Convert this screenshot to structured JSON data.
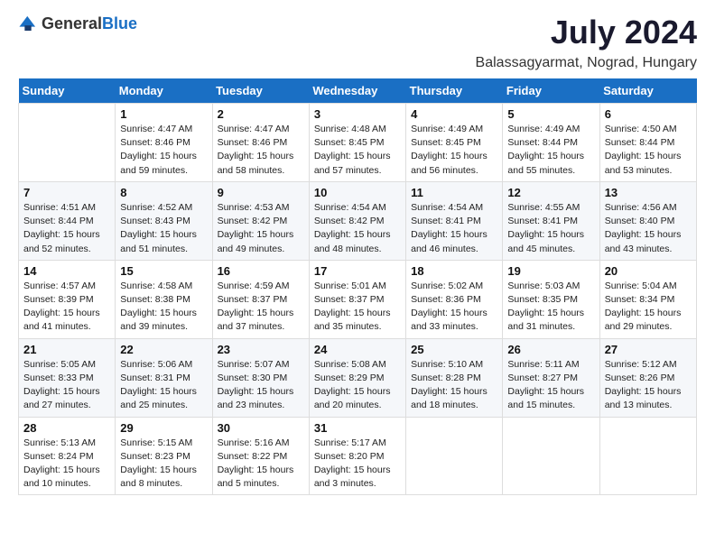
{
  "header": {
    "logo_general": "General",
    "logo_blue": "Blue",
    "month_year": "July 2024",
    "location": "Balassagyarmat, Nograd, Hungary"
  },
  "days_of_week": [
    "Sunday",
    "Monday",
    "Tuesday",
    "Wednesday",
    "Thursday",
    "Friday",
    "Saturday"
  ],
  "weeks": [
    [
      {
        "date": "",
        "sunrise": "",
        "sunset": "",
        "daylight": ""
      },
      {
        "date": "1",
        "sunrise": "Sunrise: 4:47 AM",
        "sunset": "Sunset: 8:46 PM",
        "daylight": "Daylight: 15 hours and 59 minutes."
      },
      {
        "date": "2",
        "sunrise": "Sunrise: 4:47 AM",
        "sunset": "Sunset: 8:46 PM",
        "daylight": "Daylight: 15 hours and 58 minutes."
      },
      {
        "date": "3",
        "sunrise": "Sunrise: 4:48 AM",
        "sunset": "Sunset: 8:45 PM",
        "daylight": "Daylight: 15 hours and 57 minutes."
      },
      {
        "date": "4",
        "sunrise": "Sunrise: 4:49 AM",
        "sunset": "Sunset: 8:45 PM",
        "daylight": "Daylight: 15 hours and 56 minutes."
      },
      {
        "date": "5",
        "sunrise": "Sunrise: 4:49 AM",
        "sunset": "Sunset: 8:44 PM",
        "daylight": "Daylight: 15 hours and 55 minutes."
      },
      {
        "date": "6",
        "sunrise": "Sunrise: 4:50 AM",
        "sunset": "Sunset: 8:44 PM",
        "daylight": "Daylight: 15 hours and 53 minutes."
      }
    ],
    [
      {
        "date": "7",
        "sunrise": "Sunrise: 4:51 AM",
        "sunset": "Sunset: 8:44 PM",
        "daylight": "Daylight: 15 hours and 52 minutes."
      },
      {
        "date": "8",
        "sunrise": "Sunrise: 4:52 AM",
        "sunset": "Sunset: 8:43 PM",
        "daylight": "Daylight: 15 hours and 51 minutes."
      },
      {
        "date": "9",
        "sunrise": "Sunrise: 4:53 AM",
        "sunset": "Sunset: 8:42 PM",
        "daylight": "Daylight: 15 hours and 49 minutes."
      },
      {
        "date": "10",
        "sunrise": "Sunrise: 4:54 AM",
        "sunset": "Sunset: 8:42 PM",
        "daylight": "Daylight: 15 hours and 48 minutes."
      },
      {
        "date": "11",
        "sunrise": "Sunrise: 4:54 AM",
        "sunset": "Sunset: 8:41 PM",
        "daylight": "Daylight: 15 hours and 46 minutes."
      },
      {
        "date": "12",
        "sunrise": "Sunrise: 4:55 AM",
        "sunset": "Sunset: 8:41 PM",
        "daylight": "Daylight: 15 hours and 45 minutes."
      },
      {
        "date": "13",
        "sunrise": "Sunrise: 4:56 AM",
        "sunset": "Sunset: 8:40 PM",
        "daylight": "Daylight: 15 hours and 43 minutes."
      }
    ],
    [
      {
        "date": "14",
        "sunrise": "Sunrise: 4:57 AM",
        "sunset": "Sunset: 8:39 PM",
        "daylight": "Daylight: 15 hours and 41 minutes."
      },
      {
        "date": "15",
        "sunrise": "Sunrise: 4:58 AM",
        "sunset": "Sunset: 8:38 PM",
        "daylight": "Daylight: 15 hours and 39 minutes."
      },
      {
        "date": "16",
        "sunrise": "Sunrise: 4:59 AM",
        "sunset": "Sunset: 8:37 PM",
        "daylight": "Daylight: 15 hours and 37 minutes."
      },
      {
        "date": "17",
        "sunrise": "Sunrise: 5:01 AM",
        "sunset": "Sunset: 8:37 PM",
        "daylight": "Daylight: 15 hours and 35 minutes."
      },
      {
        "date": "18",
        "sunrise": "Sunrise: 5:02 AM",
        "sunset": "Sunset: 8:36 PM",
        "daylight": "Daylight: 15 hours and 33 minutes."
      },
      {
        "date": "19",
        "sunrise": "Sunrise: 5:03 AM",
        "sunset": "Sunset: 8:35 PM",
        "daylight": "Daylight: 15 hours and 31 minutes."
      },
      {
        "date": "20",
        "sunrise": "Sunrise: 5:04 AM",
        "sunset": "Sunset: 8:34 PM",
        "daylight": "Daylight: 15 hours and 29 minutes."
      }
    ],
    [
      {
        "date": "21",
        "sunrise": "Sunrise: 5:05 AM",
        "sunset": "Sunset: 8:33 PM",
        "daylight": "Daylight: 15 hours and 27 minutes."
      },
      {
        "date": "22",
        "sunrise": "Sunrise: 5:06 AM",
        "sunset": "Sunset: 8:31 PM",
        "daylight": "Daylight: 15 hours and 25 minutes."
      },
      {
        "date": "23",
        "sunrise": "Sunrise: 5:07 AM",
        "sunset": "Sunset: 8:30 PM",
        "daylight": "Daylight: 15 hours and 23 minutes."
      },
      {
        "date": "24",
        "sunrise": "Sunrise: 5:08 AM",
        "sunset": "Sunset: 8:29 PM",
        "daylight": "Daylight: 15 hours and 20 minutes."
      },
      {
        "date": "25",
        "sunrise": "Sunrise: 5:10 AM",
        "sunset": "Sunset: 8:28 PM",
        "daylight": "Daylight: 15 hours and 18 minutes."
      },
      {
        "date": "26",
        "sunrise": "Sunrise: 5:11 AM",
        "sunset": "Sunset: 8:27 PM",
        "daylight": "Daylight: 15 hours and 15 minutes."
      },
      {
        "date": "27",
        "sunrise": "Sunrise: 5:12 AM",
        "sunset": "Sunset: 8:26 PM",
        "daylight": "Daylight: 15 hours and 13 minutes."
      }
    ],
    [
      {
        "date": "28",
        "sunrise": "Sunrise: 5:13 AM",
        "sunset": "Sunset: 8:24 PM",
        "daylight": "Daylight: 15 hours and 10 minutes."
      },
      {
        "date": "29",
        "sunrise": "Sunrise: 5:15 AM",
        "sunset": "Sunset: 8:23 PM",
        "daylight": "Daylight: 15 hours and 8 minutes."
      },
      {
        "date": "30",
        "sunrise": "Sunrise: 5:16 AM",
        "sunset": "Sunset: 8:22 PM",
        "daylight": "Daylight: 15 hours and 5 minutes."
      },
      {
        "date": "31",
        "sunrise": "Sunrise: 5:17 AM",
        "sunset": "Sunset: 8:20 PM",
        "daylight": "Daylight: 15 hours and 3 minutes."
      },
      {
        "date": "",
        "sunrise": "",
        "sunset": "",
        "daylight": ""
      },
      {
        "date": "",
        "sunrise": "",
        "sunset": "",
        "daylight": ""
      },
      {
        "date": "",
        "sunrise": "",
        "sunset": "",
        "daylight": ""
      }
    ]
  ]
}
